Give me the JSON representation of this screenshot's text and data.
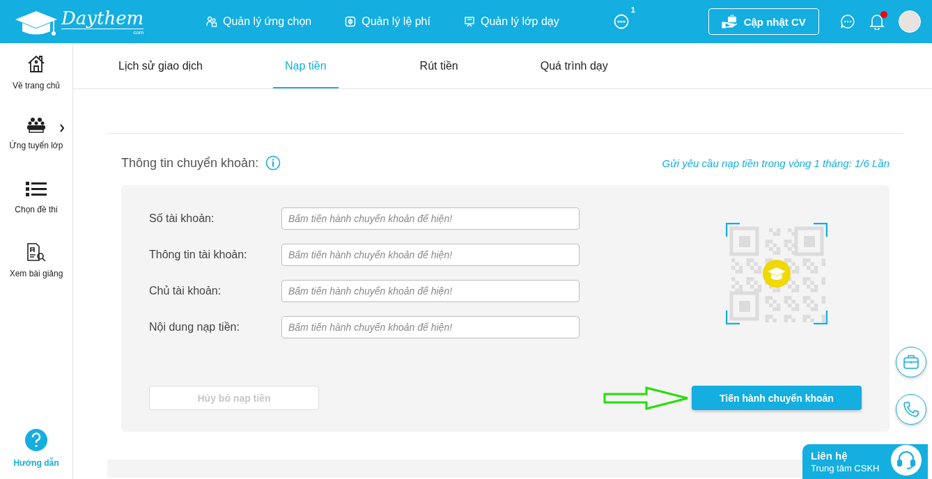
{
  "header": {
    "logo": {
      "name": "Daythem",
      "suffix": "com"
    },
    "nav": [
      {
        "label": "Quản lý ứng chọn"
      },
      {
        "label": "Quản lý lệ phí"
      },
      {
        "label": "Quản lý lớp dạy"
      }
    ],
    "more_badge": "1",
    "cv_button": "Cập nhật CV",
    "notifications": {
      "unread": true
    }
  },
  "sidebar": {
    "items": [
      {
        "label": "Về trang chủ",
        "expandable": false
      },
      {
        "label": "Ứng tuyển lớp",
        "expandable": true
      },
      {
        "label": "Chọn đề thi",
        "expandable": false
      },
      {
        "label": "Xem bài giảng",
        "expandable": false
      }
    ],
    "help": "Hướng dẫn"
  },
  "tabs": [
    {
      "label": "Lịch sử giao dịch",
      "selected": false
    },
    {
      "label": "Nạp tiền",
      "selected": true
    },
    {
      "label": "Rút tiền",
      "selected": false
    },
    {
      "label": "Quá trình dạy",
      "selected": false
    }
  ],
  "section": {
    "title": "Thông tin chuyển khoản:",
    "limit_note": "Gửi yêu cầu nạp tiền trong vòng 1 tháng: 1/6 Lần"
  },
  "fields": [
    {
      "label": "Số tài khoản:",
      "placeholder": "Bấm tiến hành chuyển khoản để hiện!"
    },
    {
      "label": "Thông tin tài khoản:",
      "placeholder": "Bấm tiến hành chuyển khoản để hiện!"
    },
    {
      "label": "Chủ tài khoản:",
      "placeholder": "Bấm tiến hành chuyển khoản để hiện!"
    },
    {
      "label": "Nội dung nạp tiền:",
      "placeholder": "Bấm tiến hành chuyển khoản để hiện!"
    }
  ],
  "cancel_button": {
    "label": "Hủy bỏ nạp tiền",
    "disabled": true
  },
  "submit_button": {
    "label": "Tiến hành chuyển khoản",
    "disabled": false
  },
  "contact": {
    "title": "Liên hệ",
    "subtitle": "Trung tâm CSKH"
  }
}
